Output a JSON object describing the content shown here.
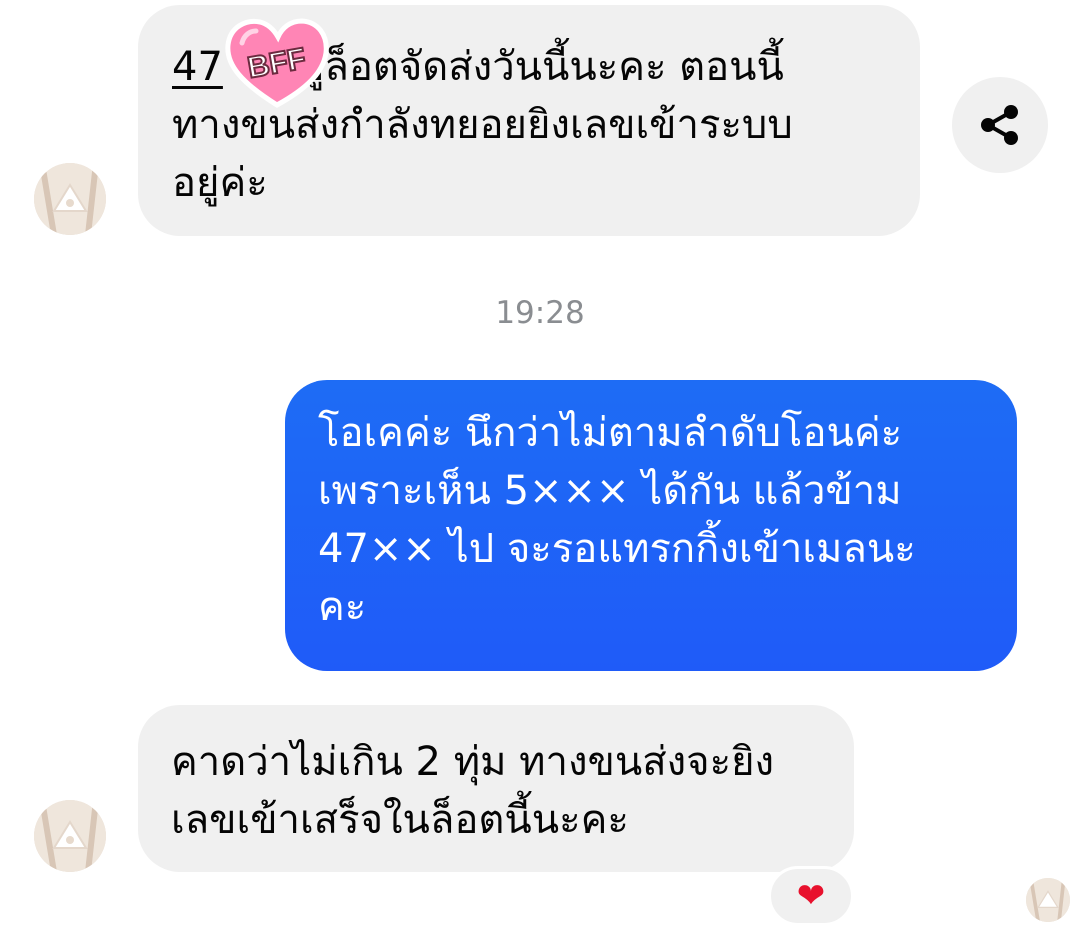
{
  "messages": [
    {
      "id": "msg1",
      "direction": "incoming",
      "lines": [
        "47××  อยู่ล็อตจัดส่งวันนี้นะคะ ตอนนี้",
        "ทางขนส่งกำลังทยอยยิงเลขเข้าระบบ",
        "อยู่ค่ะ"
      ],
      "underlined_prefix": "47",
      "line1_rest": "ยู่ล็อตจัดส่งวันนี้นะคะ ตอนนี้"
    },
    {
      "id": "msg2",
      "direction": "outgoing",
      "lines": [
        "โอเคค่ะ นึกว่าไม่ตามลำดับโอนค่ะ",
        "เพราะเห็น 5××× ได้กัน แล้วข้าม",
        "47×× ไป จะรอแทรกกิ้งเข้าเมลนะ",
        "คะ"
      ]
    },
    {
      "id": "msg3",
      "direction": "incoming",
      "lines": [
        "คาดว่าไม่เกิน 2 ทุ่ม ทางขนส่งจะยิง",
        "เลขเข้าเสร็จในล็อตนี้นะคะ"
      ]
    }
  ],
  "timestamp": "19:28",
  "sticker": {
    "text": "BFF",
    "color": "#ff7fb0"
  },
  "reaction": {
    "emoji": "❤",
    "color": "#e8112d"
  },
  "colors": {
    "outgoing": "#1f64f7",
    "incoming": "#f0f0f0",
    "timestamp": "#8a8d91"
  },
  "icons": {
    "share": "share-icon"
  }
}
